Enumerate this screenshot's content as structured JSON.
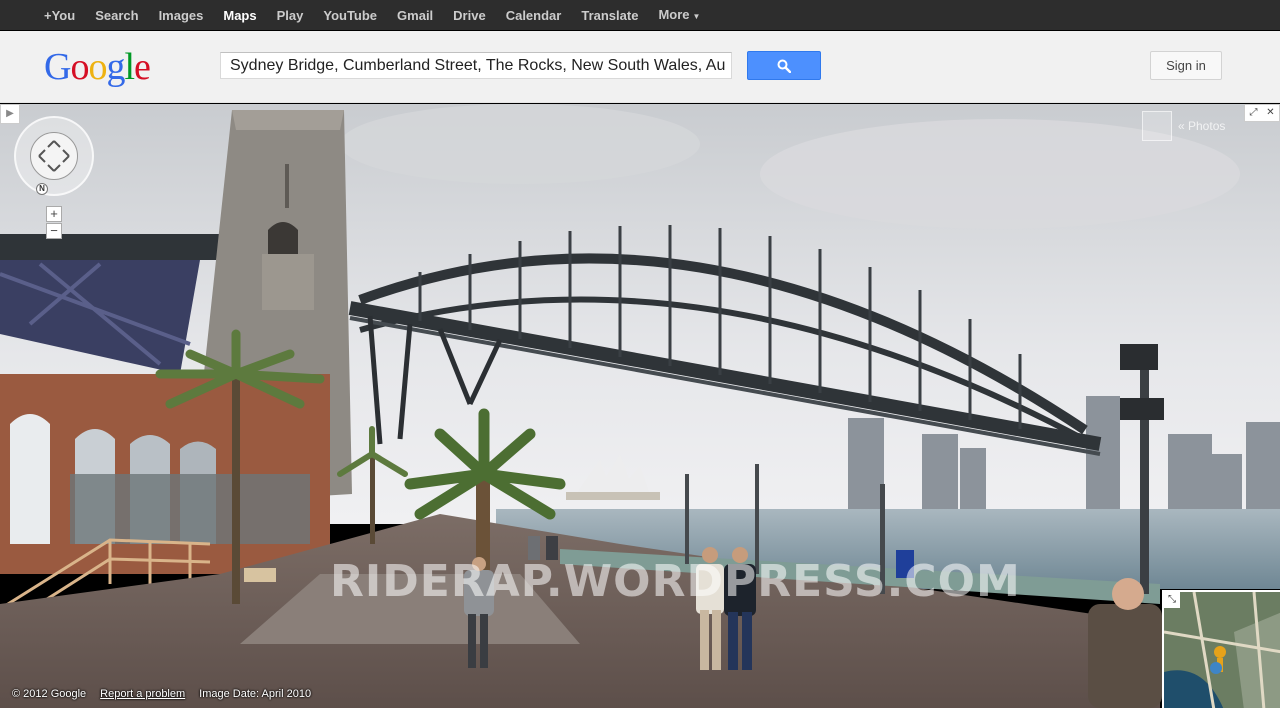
{
  "topbar": {
    "items": [
      {
        "label": "+You"
      },
      {
        "label": "Search"
      },
      {
        "label": "Images"
      },
      {
        "label": "Maps",
        "active": true
      },
      {
        "label": "Play"
      },
      {
        "label": "YouTube"
      },
      {
        "label": "Gmail"
      },
      {
        "label": "Drive"
      },
      {
        "label": "Calendar"
      },
      {
        "label": "Translate"
      },
      {
        "label": "More"
      }
    ]
  },
  "header": {
    "logo_letters": [
      "G",
      "o",
      "o",
      "g",
      "l",
      "e"
    ],
    "logo_colors": [
      "#3369e8",
      "#d50f25",
      "#eeb211",
      "#3369e8",
      "#009925",
      "#d50f25"
    ],
    "search_value": "Sydney Bridge, Cumberland Street, The Rocks, New South Wales, Au",
    "search_icon": "search-icon",
    "signin_label": "Sign in"
  },
  "streetview": {
    "photos_label": "« Photos",
    "watermark": "RIDERAP.WORDPRESS.COM",
    "compass_label": "N",
    "zoom_in": "+",
    "zoom_out": "−"
  },
  "footer": {
    "copyright": "© 2012 Google",
    "report": "Report a problem",
    "image_date": "Image Date: April 2010"
  },
  "colors": {
    "accent": "#4d90fe",
    "topbar": "#2d2d2d"
  }
}
